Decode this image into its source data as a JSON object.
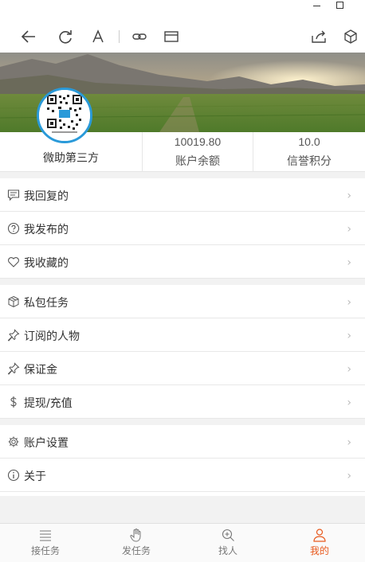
{
  "window": {
    "controls": [
      "minimize",
      "maximize"
    ]
  },
  "toolbar": {
    "icons": [
      "back-arrow-icon",
      "refresh-icon",
      "text-size-icon",
      "link-icon",
      "card-icon",
      "share-icon",
      "box-icon"
    ]
  },
  "profile": {
    "username": "微助第三方",
    "balance_value": "10019.80",
    "balance_label": "账户余额",
    "credit_value": "10.0",
    "credit_label": "信誉积分"
  },
  "menu": {
    "group1": [
      {
        "label": "我回复的",
        "icon": "comment-icon"
      },
      {
        "label": "我发布的",
        "icon": "question-circle-icon"
      },
      {
        "label": "我收藏的",
        "icon": "heart-icon"
      }
    ],
    "group2": [
      {
        "label": "私包任务",
        "icon": "package-icon"
      },
      {
        "label": "订阅的人物",
        "icon": "pin-icon"
      },
      {
        "label": "保证金",
        "icon": "pin-icon"
      },
      {
        "label": "提现/充值",
        "icon": "dollar-icon"
      }
    ],
    "group3": [
      {
        "label": "账户设置",
        "icon": "gear-icon"
      },
      {
        "label": "关于",
        "icon": "info-icon"
      }
    ],
    "chevron": "›"
  },
  "tabbar": {
    "tabs": [
      {
        "label": "接任务",
        "icon": "list-icon",
        "active": false
      },
      {
        "label": "发任务",
        "icon": "hand-icon",
        "active": false
      },
      {
        "label": "找人",
        "icon": "search-plus-icon",
        "active": false
      },
      {
        "label": "我的",
        "icon": "person-icon",
        "active": true
      }
    ],
    "active_color": "#e8591d"
  },
  "colors": {
    "accent": "#e8591d",
    "avatar_border": "#2a9ad9"
  }
}
